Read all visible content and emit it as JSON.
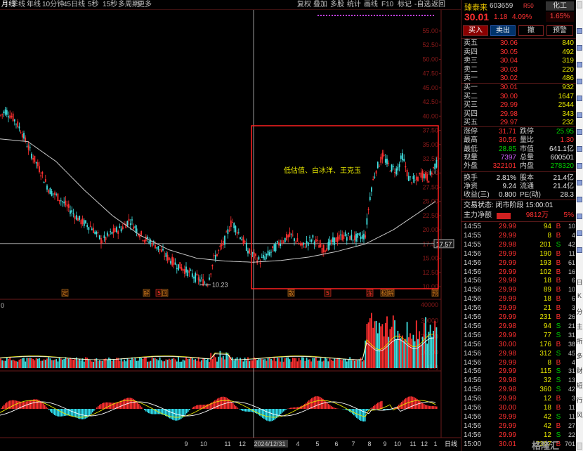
{
  "toolbar": {
    "left_items": [
      "月线",
      "季线",
      "年线",
      "10分钟",
      "45日线",
      "5秒",
      "15秒",
      "多周期",
      "更多"
    ],
    "right_items": [
      "复权",
      "叠加",
      "多股",
      "统计",
      "画线",
      "F10",
      "标记",
      "-自选",
      "返回"
    ]
  },
  "chart": {
    "price_axis": [
      "55.00",
      "52.50",
      "50.00",
      "47.50",
      "45.00",
      "42.50",
      "40.00",
      "37.50",
      "35.00",
      "32.50",
      "30.00",
      "27.50",
      "25.00",
      "22.50",
      "20.00",
      "17.50",
      "15.00",
      "12.50",
      "10.00"
    ],
    "current_price_tag": "17.57",
    "low_label": "10.23",
    "annotation": "低估值、白冰洋、王克玉",
    "volume_axis": [
      "40000",
      "30000",
      "20000",
      "10000",
      "(10)"
    ],
    "volume_left_label": "0",
    "date_labels": [
      "9",
      "10",
      "11",
      "12",
      "2024/12/31",
      "4",
      "5",
      "6",
      "7",
      "8",
      "9",
      "10",
      "11",
      "12",
      "1"
    ],
    "date_label_right": "日线",
    "event_markers": [
      {
        "text": "定",
        "color": "#d08020"
      },
      {
        "text": "解",
        "color": "#d08020"
      },
      {
        "text": "5",
        "color": "#ff3030"
      },
      {
        "text": "回",
        "color": "#d08020"
      },
      {
        "text": "散",
        "color": "#d08020"
      },
      {
        "text": "5",
        "color": "#ff3030"
      },
      {
        "text": "冻",
        "color": "#ff3030"
      },
      {
        "text": "极",
        "color": "#d08020"
      },
      {
        "text": "解",
        "color": "#d08020"
      },
      {
        "text": "预",
        "color": "#d08020"
      }
    ]
  },
  "quote": {
    "name": "臻泰来",
    "code": "603659",
    "r_tag": "R50",
    "sector": "化工",
    "sector_pct": "1.65%",
    "price": "30.01",
    "change": "1.18",
    "change_pct": "4.09%",
    "buttons": {
      "buy": "买入",
      "sell": "卖出",
      "x": "撤",
      "warn": "预警"
    },
    "asks": [
      {
        "label": "卖五",
        "price": "30.06",
        "vol": "840"
      },
      {
        "label": "卖四",
        "price": "30.05",
        "vol": "492"
      },
      {
        "label": "卖三",
        "price": "30.04",
        "vol": "319"
      },
      {
        "label": "卖二",
        "price": "30.03",
        "vol": "220"
      },
      {
        "label": "卖一",
        "price": "30.02",
        "vol": "486"
      }
    ],
    "bids": [
      {
        "label": "买一",
        "price": "30.01",
        "vol": "932"
      },
      {
        "label": "买二",
        "price": "30.00",
        "vol": "1647"
      },
      {
        "label": "买三",
        "price": "29.99",
        "vol": "2544"
      },
      {
        "label": "买四",
        "price": "29.98",
        "vol": "343"
      },
      {
        "label": "买五",
        "price": "29.97",
        "vol": "232"
      }
    ],
    "stats": {
      "limit_up_k": "涨停",
      "limit_up": "31.71",
      "limit_down_k": "跌停",
      "limit_down": "25.95",
      "high_k": "最高",
      "high": "30.56",
      "vol_ratio_k": "量比",
      "vol_ratio": "1.30",
      "low_k": "最低",
      "low": "28.85",
      "mktcap_k": "市值",
      "mktcap": "641.1亿",
      "now_k": "现量",
      "now": "7397",
      "total_k": "总量",
      "total": "600501",
      "outer_k": "外盘",
      "outer": "322101",
      "inner_k": "内盘",
      "inner": "278320",
      "turnover_k": "换手",
      "turnover": "2.81%",
      "shares_k": "股本",
      "shares": "21.4亿",
      "nav_k": "净资",
      "nav": "9.24",
      "float_k": "流通",
      "float": "21.4亿",
      "eps_k": "收益(三)",
      "eps": "0.800",
      "pe_k": "PE(动)",
      "pe": "28.3"
    },
    "trade_state": "交易状态: 闭市阶段 15:00:01",
    "main_flow_label": "主力净额",
    "main_flow": "9812万",
    "main_flow_pct": "5%",
    "ticks": [
      {
        "t": "14:55",
        "p": "29.99",
        "v": "94",
        "d": "B",
        "n": "10"
      },
      {
        "t": "14:55",
        "p": "29.99",
        "v": "8",
        "d": "B",
        "n": "4"
      },
      {
        "t": "14:55",
        "p": "29.98",
        "v": "201",
        "d": "S",
        "n": "42"
      },
      {
        "t": "14:56",
        "p": "29.99",
        "v": "190",
        "d": "B",
        "n": "11"
      },
      {
        "t": "14:56",
        "p": "29.99",
        "v": "193",
        "d": "B",
        "n": "61"
      },
      {
        "t": "14:56",
        "p": "29.99",
        "v": "102",
        "d": "B",
        "n": "16"
      },
      {
        "t": "14:56",
        "p": "29.99",
        "v": "18",
        "d": "B",
        "n": "6"
      },
      {
        "t": "14:56",
        "p": "29.99",
        "v": "89",
        "d": "B",
        "n": "10"
      },
      {
        "t": "14:56",
        "p": "29.99",
        "v": "18",
        "d": "B",
        "n": "6"
      },
      {
        "t": "14:56",
        "p": "29.99",
        "v": "21",
        "d": "B",
        "n": "3"
      },
      {
        "t": "14:56",
        "p": "29.99",
        "v": "231",
        "d": "B",
        "n": "26"
      },
      {
        "t": "14:56",
        "p": "29.98",
        "v": "94",
        "d": "S",
        "n": "21"
      },
      {
        "t": "14:56",
        "p": "29.99",
        "v": "77",
        "d": "S",
        "n": "31"
      },
      {
        "t": "14:56",
        "p": "30.00",
        "v": "176",
        "d": "B",
        "n": "38"
      },
      {
        "t": "14:56",
        "p": "29.98",
        "v": "312",
        "d": "S",
        "n": "45"
      },
      {
        "t": "14:56",
        "p": "29.99",
        "v": "8",
        "d": "B",
        "n": "4"
      },
      {
        "t": "14:56",
        "p": "29.99",
        "v": "115",
        "d": "S",
        "n": "31"
      },
      {
        "t": "14:56",
        "p": "29.98",
        "v": "32",
        "d": "S",
        "n": "13"
      },
      {
        "t": "14:56",
        "p": "29.98",
        "v": "360",
        "d": "S",
        "n": "42"
      },
      {
        "t": "14:56",
        "p": "29.99",
        "v": "12",
        "d": "B",
        "n": "3"
      },
      {
        "t": "14:56",
        "p": "30.00",
        "v": "18",
        "d": "B",
        "n": "11"
      },
      {
        "t": "14:56",
        "p": "29.99",
        "v": "42",
        "d": "S",
        "n": "11"
      },
      {
        "t": "14:56",
        "p": "29.99",
        "v": "42",
        "d": "B",
        "n": "27"
      },
      {
        "t": "14:56",
        "p": "29.99",
        "v": "12",
        "d": "S",
        "n": "22"
      },
      {
        "t": "15:00",
        "p": "30.01",
        "v": "7397",
        "d": "B",
        "n": "701"
      }
    ],
    "scrollbar_glyphs": [
      "日",
      "K",
      "分",
      "主",
      "所",
      "多",
      "财",
      "短",
      "行",
      "风"
    ]
  },
  "watermark": "格隆汇",
  "colors": {
    "up": "#ff3030",
    "down": "#00d000",
    "bg": "#000000",
    "ma": "#c8c8c8",
    "highlight_box": "#ff2020"
  }
}
